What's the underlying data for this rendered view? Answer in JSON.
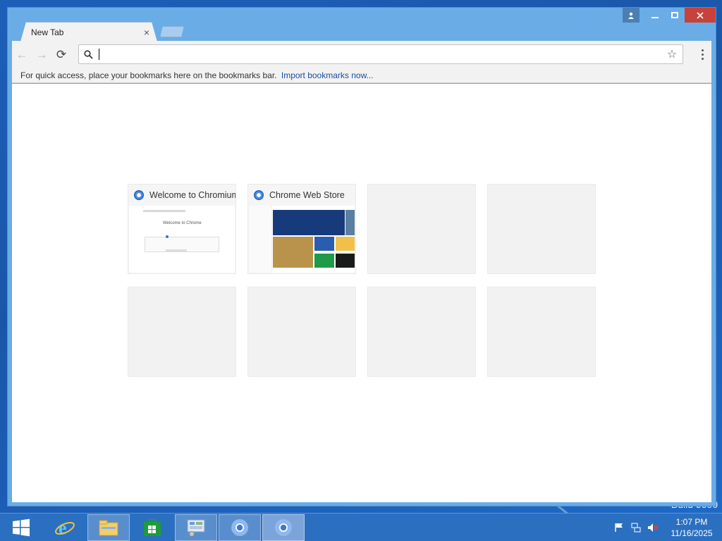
{
  "desktop": {
    "build_text": "Build 9600"
  },
  "window": {
    "tab": {
      "title": "New Tab",
      "close_glyph": "×"
    },
    "caption": {
      "minimize": "minimize-icon",
      "maximize": "maximize-icon",
      "close": "close-icon",
      "profile": "profile-icon"
    }
  },
  "toolbar": {
    "back": "←",
    "forward": "→",
    "reload": "⟳",
    "omnibox": {
      "value": "",
      "placeholder": ""
    },
    "star": "☆"
  },
  "bookmarks_bar": {
    "message": "For quick access, place your bookmarks here on the bookmarks bar.",
    "import_link": "Import bookmarks now..."
  },
  "tiles": [
    {
      "title": "Welcome to Chromium",
      "thumb_title": "Welcome to Chrome"
    },
    {
      "title": "Chrome Web Store"
    }
  ],
  "taskbar": {
    "items": [
      "start-icon",
      "internet-explorer-icon",
      "file-explorer-icon",
      "store-icon",
      "control-panel-icon",
      "chromium-icon",
      "chromium-icon"
    ],
    "clock": {
      "time": "1:07 PM",
      "date": "11/16/2025"
    }
  },
  "colors": {
    "window_frame": "#6aace6",
    "taskbar": "#2b6fc0",
    "close_button": "#c8413a",
    "link": "#1a4fa0"
  }
}
